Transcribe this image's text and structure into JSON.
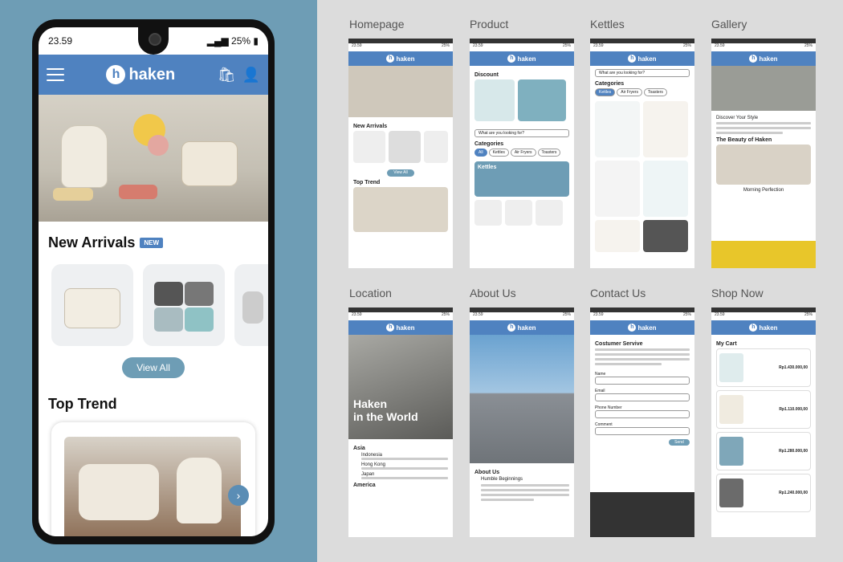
{
  "phone": {
    "status_time": "23.59",
    "status_battery": "25%",
    "brand": "haken",
    "logo_letter": "h",
    "new_arrivals_title": "New Arrivals",
    "new_badge": "NEW",
    "view_all": "View All",
    "top_trend_title": "Top Trend"
  },
  "screens": {
    "homepage": "Homepage",
    "product": "Product",
    "kettles": "Kettles",
    "gallery": "Gallery",
    "location": "Location",
    "about": "About Us",
    "contact": "Contact Us",
    "shop": "Shop Now"
  },
  "mini": {
    "time": "23.59",
    "battery": "25%",
    "brand": "haken",
    "new_arrivals": "New Arrivals",
    "view_all": "View All",
    "top_trend": "Top Trend",
    "discount": "Discount",
    "search_placeholder": "What are you looking for?",
    "categories": "Categories",
    "cat_all": "All",
    "cat_kettles": "Kettles",
    "cat_airfryers": "Air Fryers",
    "cat_toasters": "Toasters",
    "kettles_banner": "Kettles",
    "discover": "Discover Your Style",
    "beauty": "The Beauty of Haken",
    "morning": "Morning Perfection",
    "haken_world_1": "Haken",
    "haken_world_2": "in the World",
    "asia": "Asia",
    "indonesia": "Indonesia",
    "hongkong": "Hong Kong",
    "japan": "Japan",
    "america": "America",
    "about_us": "About Us",
    "humble": "Humble Beginnings",
    "customer_service": "Costumer Servive",
    "name": "Name",
    "email": "Email",
    "phone": "Phone Number",
    "comment": "Comment",
    "send": "Send",
    "my_cart": "My Cart",
    "price1": "Rp1.430.000,00",
    "price2": "Rp1.110.000,00",
    "price3": "Rp1.280.000,00",
    "price4": "Rp1.240.000,00"
  }
}
